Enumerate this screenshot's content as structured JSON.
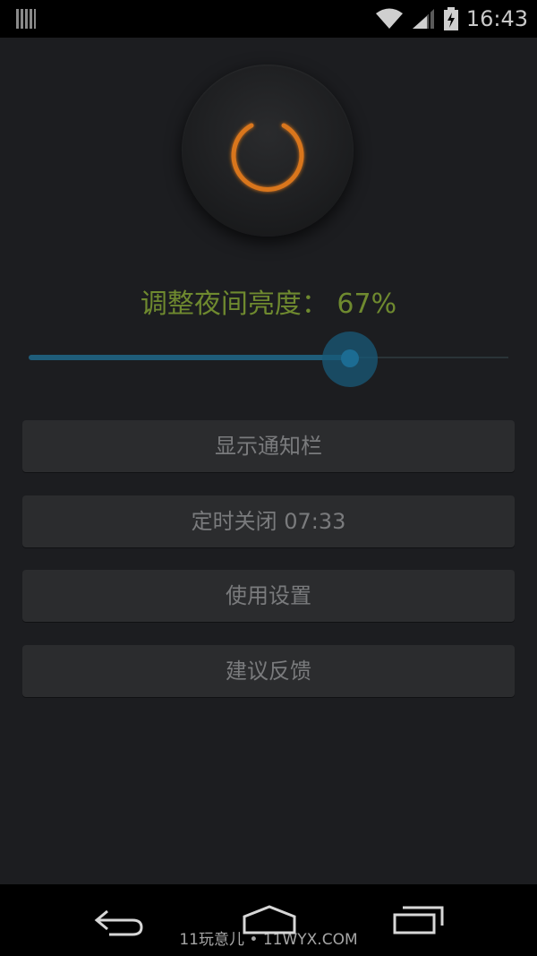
{
  "status_bar": {
    "time": "16:43",
    "icons": [
      "barcode-icon",
      "wifi-icon",
      "signal-icon",
      "battery-charging-icon"
    ]
  },
  "power": {
    "icon": "power-icon",
    "accent_color": "#d9761f"
  },
  "brightness": {
    "label": "调整夜间亮度： 67%",
    "percent": 67,
    "label_color": "#6f8a2f"
  },
  "buttons": [
    {
      "label": "显示通知栏"
    },
    {
      "label": "定时关闭 07:33"
    },
    {
      "label": "使用设置"
    },
    {
      "label": "建议反馈"
    }
  ],
  "nav_bar": {
    "icons": [
      "back-icon",
      "home-icon",
      "recent-apps-icon"
    ],
    "watermark": "11玩意儿 • 11WYX.COM"
  }
}
